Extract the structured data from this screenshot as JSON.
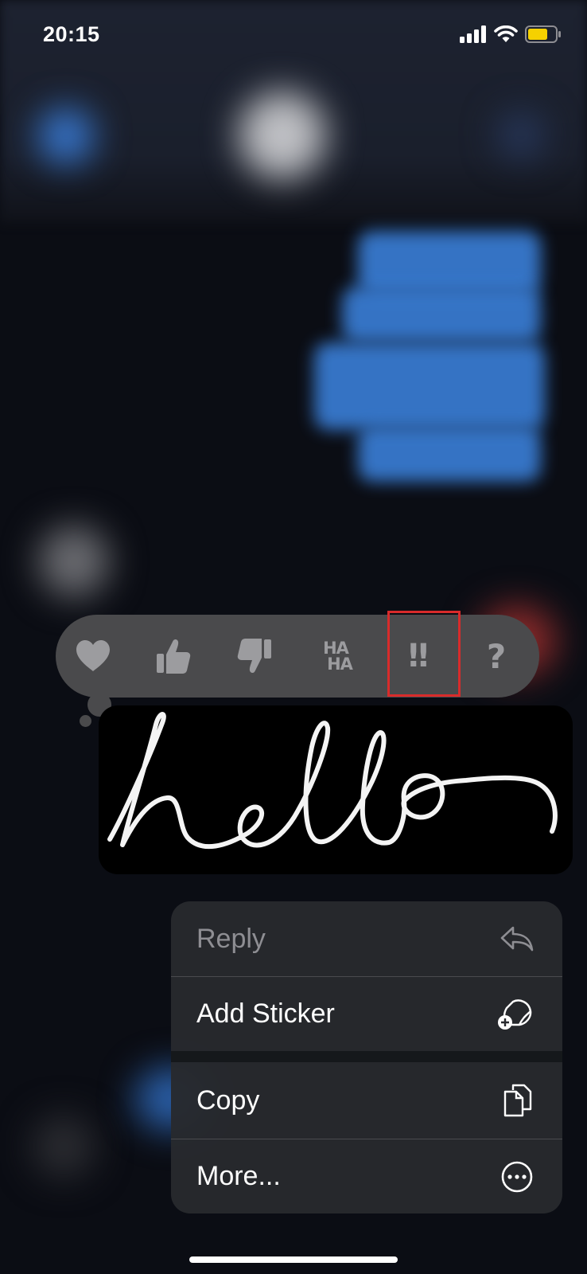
{
  "status_bar": {
    "time": "20:15",
    "icons": [
      "cellular-signal-icon",
      "wifi-icon",
      "battery-icon"
    ],
    "battery_color": "#f5d100"
  },
  "tapback": {
    "items": [
      {
        "name": "heart",
        "icon": "heart-icon"
      },
      {
        "name": "thumbs-up",
        "icon": "thumbs-up-icon"
      },
      {
        "name": "thumbs-down",
        "icon": "thumbs-down-icon"
      },
      {
        "name": "haha",
        "icon": "haha-icon",
        "line1": "HA",
        "line2": "HA"
      },
      {
        "name": "exclamation",
        "icon": "double-exclamation-icon",
        "glyph": "‼",
        "highlighted": true
      },
      {
        "name": "question",
        "icon": "question-icon",
        "glyph": "?"
      }
    ],
    "highlight_color": "#d92b2b"
  },
  "message": {
    "type": "handwritten",
    "text": "hello"
  },
  "context_menu": {
    "items": [
      {
        "label": "Reply",
        "icon": "reply-arrow-icon",
        "disabled": true
      },
      {
        "label": "Add Sticker",
        "icon": "add-sticker-icon"
      },
      {
        "label": "Copy",
        "icon": "copy-icon"
      },
      {
        "label": "More...",
        "icon": "more-ellipsis-icon"
      }
    ]
  },
  "colors": {
    "bubble_blue": "#3a7fd8",
    "tapback_bg": "#4a4a4c",
    "menu_bg": "#28292e"
  }
}
